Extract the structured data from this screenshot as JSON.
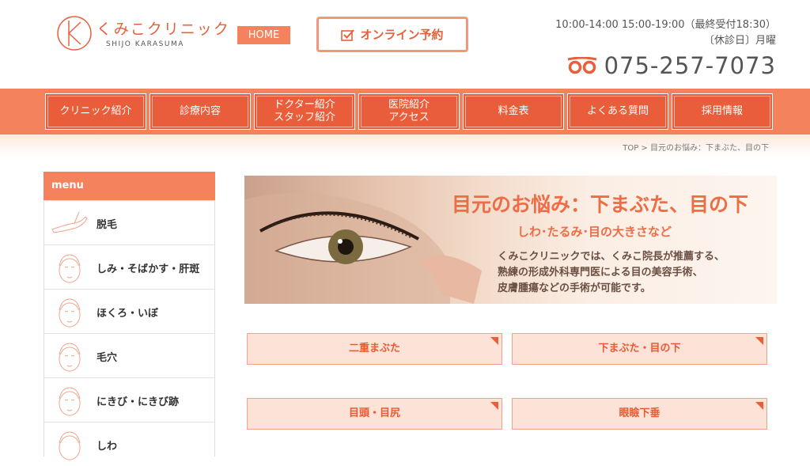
{
  "header": {
    "logo_name": "くみこクリニック",
    "logo_sub": "SHIJO KARASUMA",
    "home_label": "HOME",
    "reserve_label": "オンライン予約",
    "hours_line1": "10:00-14:00 15:00-19:00（最終受付18:30）",
    "hours_line2": "〔休診日〕月曜",
    "phone": "075-257-7073",
    "colors": {
      "accent": "#f4825d",
      "accent_dark": "#ea5d3a",
      "text_orange": "#e8603b"
    }
  },
  "nav": {
    "items": [
      {
        "label": "クリニック紹介"
      },
      {
        "label": "診療内容"
      },
      {
        "label1": "ドクター紹介",
        "label2": "スタッフ紹介"
      },
      {
        "label1": "医院紹介",
        "label2": "アクセス"
      },
      {
        "label": "料金表"
      },
      {
        "label": "よくある質問"
      },
      {
        "label": "採用情報"
      }
    ]
  },
  "breadcrumb": {
    "top": "TOP",
    "sep": ">",
    "current": "目元のお悩み：下まぶた、目の下"
  },
  "sidebar": {
    "title": "menu",
    "items": [
      {
        "label": "脱毛",
        "icon": "leg-icon"
      },
      {
        "label": "しみ・そばかす・肝斑",
        "icon": "face-icon"
      },
      {
        "label": "ほくろ・いぼ",
        "icon": "face-icon"
      },
      {
        "label": "毛穴",
        "icon": "face-icon"
      },
      {
        "label": "にきび・にきび跡",
        "icon": "face-icon"
      },
      {
        "label": "しわ",
        "icon": "face-icon"
      }
    ]
  },
  "hero": {
    "title": "目元のお悩み：下まぶた、目の下",
    "subtitle": "しわ･たるみ･目の大きさなど",
    "desc1": "くみこクリニックでは、くみこ院長が推薦する、",
    "desc2": "熟練の形成外科専門医による目の美容手術、",
    "desc3": "皮膚腫瘍などの手術が可能です。"
  },
  "buttons": [
    {
      "label": "二重まぶた"
    },
    {
      "label": "下まぶた・目の下"
    },
    {
      "label": "目頭・目尻"
    },
    {
      "label": "眼瞼下垂"
    }
  ]
}
